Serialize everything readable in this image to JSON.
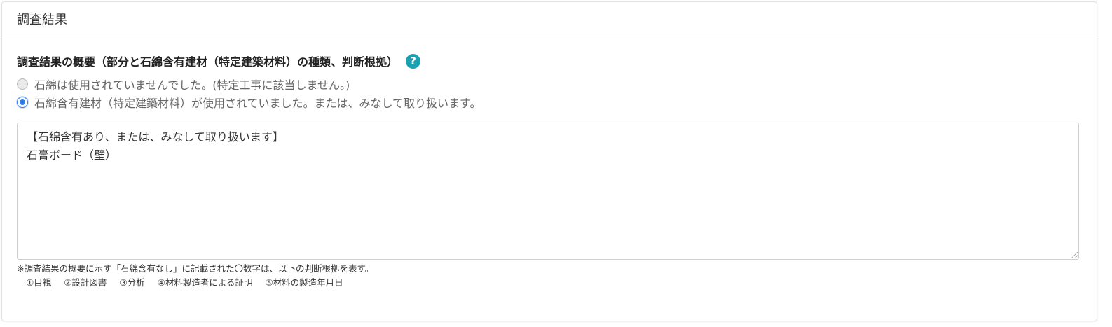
{
  "header": {
    "title": "調査結果"
  },
  "section": {
    "title": "調査結果の概要（部分と石綿含有建材（特定建築材料）の種類、判断根拠）",
    "help_icon": "question-circle-icon",
    "help_glyph": "?"
  },
  "radios": [
    {
      "label": "石綿は使用されていませんでした。(特定工事に該当しません。)",
      "checked": false
    },
    {
      "label": "石綿含有建材（特定建築材料）が使用されていました。または、みなして取り扱います。",
      "checked": true
    }
  ],
  "textarea": {
    "line1": "【石綿含有あり、または、みなして取り扱います】",
    "line2": "石膏ボード（壁）"
  },
  "note": {
    "text": "※調査結果の概要に示す「石綿含有なし」に記載された〇数字は、以下の判断根拠を表す。",
    "items": [
      "①目視",
      "②設計図書",
      "③分析",
      "④材料製造者による証明",
      "⑤材料の製造年月日"
    ]
  },
  "colors": {
    "accent": "#2b7de9",
    "help": "#1aa0b3"
  }
}
